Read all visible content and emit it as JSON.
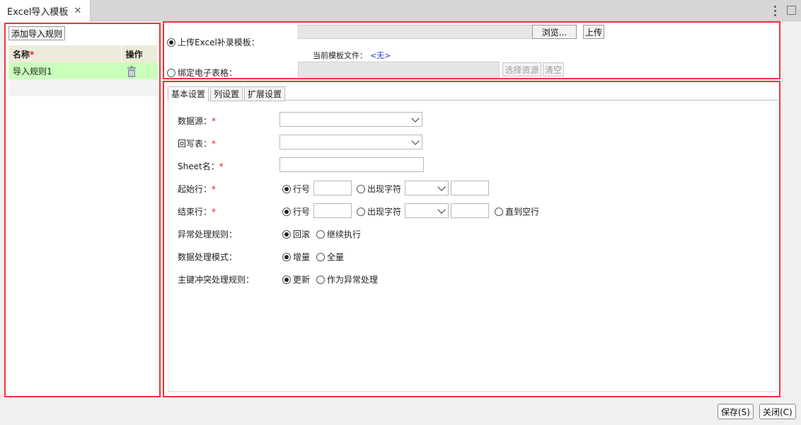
{
  "window": {
    "tab_title": "Excel导入模板",
    "close_glyph": "✕"
  },
  "left": {
    "add_rule_label": "添加导入规则",
    "columns": {
      "name": "名称",
      "required_mark": "*",
      "action": "操作"
    },
    "rows": [
      {
        "name": "导入规则1",
        "action_icon": "trash-icon"
      }
    ]
  },
  "source": {
    "upload_option_label": "上传Excel补录模板：",
    "upload_selected": true,
    "browse_label": "浏览...",
    "upload_label": "上传",
    "current_file_label": "当前模板文件：",
    "current_file_value": "<无>",
    "bind_option_label": "绑定电子表格：",
    "bind_selected": false,
    "select_resource_label": "选择资源",
    "clear_label": "清空"
  },
  "settings": {
    "tabs": [
      {
        "label": "基本设置",
        "active": true
      },
      {
        "label": "列设置",
        "active": false
      },
      {
        "label": "扩展设置",
        "active": false
      }
    ],
    "fields": {
      "datasource": {
        "label": "数据源：",
        "required": "*",
        "value": ""
      },
      "writeback_table": {
        "label": "回写表：",
        "required": "*",
        "value": ""
      },
      "sheet_name": {
        "label": "Sheet名：",
        "required": "*",
        "value": ""
      },
      "start_row": {
        "label": "起始行：",
        "required": "*",
        "opt_row_number": "行号",
        "opt_row_number_selected": true,
        "opt_appear_char": "出现字符",
        "opt_appear_char_selected": false
      },
      "end_row": {
        "label": "结束行：",
        "required": "*",
        "opt_row_number": "行号",
        "opt_row_number_selected": true,
        "opt_appear_char": "出现字符",
        "opt_appear_char_selected": false,
        "opt_until_empty": "直到空行",
        "opt_until_empty_selected": false
      },
      "error_rule": {
        "label": "异常处理规则：",
        "opt_rollback": "回滚",
        "opt_rollback_selected": true,
        "opt_continue": "继续执行",
        "opt_continue_selected": false
      },
      "process_mode": {
        "label": "数据处理模式：",
        "opt_incremental": "增量",
        "opt_incremental_selected": true,
        "opt_full": "全量",
        "opt_full_selected": false
      },
      "pk_conflict": {
        "label": "主键冲突处理规则：",
        "opt_update": "更新",
        "opt_update_selected": true,
        "opt_as_error": "作为异常处理",
        "opt_as_error_selected": false
      }
    }
  },
  "footer": {
    "save_label": "保存(S)",
    "close_label": "关闭(C)"
  },
  "colors": {
    "highlight_border": "#e8383c",
    "selected_row": "#c9ffbb",
    "header_bg": "#ecebd9",
    "required": "#e02020",
    "link_value": "#1a3fd0"
  }
}
